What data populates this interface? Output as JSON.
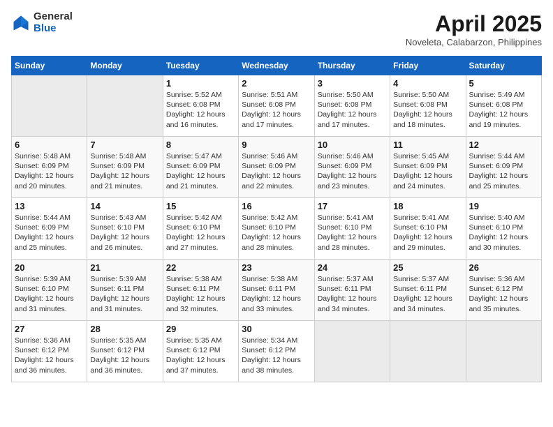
{
  "header": {
    "logo": {
      "line1": "General",
      "line2": "Blue"
    },
    "month_year": "April 2025",
    "location": "Noveleta, Calabarzon, Philippines"
  },
  "weekdays": [
    "Sunday",
    "Monday",
    "Tuesday",
    "Wednesday",
    "Thursday",
    "Friday",
    "Saturday"
  ],
  "weeks": [
    [
      {
        "day": "",
        "sunrise": "",
        "sunset": "",
        "daylight": ""
      },
      {
        "day": "",
        "sunrise": "",
        "sunset": "",
        "daylight": ""
      },
      {
        "day": "1",
        "sunrise": "Sunrise: 5:52 AM",
        "sunset": "Sunset: 6:08 PM",
        "daylight": "Daylight: 12 hours and 16 minutes."
      },
      {
        "day": "2",
        "sunrise": "Sunrise: 5:51 AM",
        "sunset": "Sunset: 6:08 PM",
        "daylight": "Daylight: 12 hours and 17 minutes."
      },
      {
        "day": "3",
        "sunrise": "Sunrise: 5:50 AM",
        "sunset": "Sunset: 6:08 PM",
        "daylight": "Daylight: 12 hours and 17 minutes."
      },
      {
        "day": "4",
        "sunrise": "Sunrise: 5:50 AM",
        "sunset": "Sunset: 6:08 PM",
        "daylight": "Daylight: 12 hours and 18 minutes."
      },
      {
        "day": "5",
        "sunrise": "Sunrise: 5:49 AM",
        "sunset": "Sunset: 6:08 PM",
        "daylight": "Daylight: 12 hours and 19 minutes."
      }
    ],
    [
      {
        "day": "6",
        "sunrise": "Sunrise: 5:48 AM",
        "sunset": "Sunset: 6:09 PM",
        "daylight": "Daylight: 12 hours and 20 minutes."
      },
      {
        "day": "7",
        "sunrise": "Sunrise: 5:48 AM",
        "sunset": "Sunset: 6:09 PM",
        "daylight": "Daylight: 12 hours and 21 minutes."
      },
      {
        "day": "8",
        "sunrise": "Sunrise: 5:47 AM",
        "sunset": "Sunset: 6:09 PM",
        "daylight": "Daylight: 12 hours and 21 minutes."
      },
      {
        "day": "9",
        "sunrise": "Sunrise: 5:46 AM",
        "sunset": "Sunset: 6:09 PM",
        "daylight": "Daylight: 12 hours and 22 minutes."
      },
      {
        "day": "10",
        "sunrise": "Sunrise: 5:46 AM",
        "sunset": "Sunset: 6:09 PM",
        "daylight": "Daylight: 12 hours and 23 minutes."
      },
      {
        "day": "11",
        "sunrise": "Sunrise: 5:45 AM",
        "sunset": "Sunset: 6:09 PM",
        "daylight": "Daylight: 12 hours and 24 minutes."
      },
      {
        "day": "12",
        "sunrise": "Sunrise: 5:44 AM",
        "sunset": "Sunset: 6:09 PM",
        "daylight": "Daylight: 12 hours and 25 minutes."
      }
    ],
    [
      {
        "day": "13",
        "sunrise": "Sunrise: 5:44 AM",
        "sunset": "Sunset: 6:09 PM",
        "daylight": "Daylight: 12 hours and 25 minutes."
      },
      {
        "day": "14",
        "sunrise": "Sunrise: 5:43 AM",
        "sunset": "Sunset: 6:10 PM",
        "daylight": "Daylight: 12 hours and 26 minutes."
      },
      {
        "day": "15",
        "sunrise": "Sunrise: 5:42 AM",
        "sunset": "Sunset: 6:10 PM",
        "daylight": "Daylight: 12 hours and 27 minutes."
      },
      {
        "day": "16",
        "sunrise": "Sunrise: 5:42 AM",
        "sunset": "Sunset: 6:10 PM",
        "daylight": "Daylight: 12 hours and 28 minutes."
      },
      {
        "day": "17",
        "sunrise": "Sunrise: 5:41 AM",
        "sunset": "Sunset: 6:10 PM",
        "daylight": "Daylight: 12 hours and 28 minutes."
      },
      {
        "day": "18",
        "sunrise": "Sunrise: 5:41 AM",
        "sunset": "Sunset: 6:10 PM",
        "daylight": "Daylight: 12 hours and 29 minutes."
      },
      {
        "day": "19",
        "sunrise": "Sunrise: 5:40 AM",
        "sunset": "Sunset: 6:10 PM",
        "daylight": "Daylight: 12 hours and 30 minutes."
      }
    ],
    [
      {
        "day": "20",
        "sunrise": "Sunrise: 5:39 AM",
        "sunset": "Sunset: 6:10 PM",
        "daylight": "Daylight: 12 hours and 31 minutes."
      },
      {
        "day": "21",
        "sunrise": "Sunrise: 5:39 AM",
        "sunset": "Sunset: 6:11 PM",
        "daylight": "Daylight: 12 hours and 31 minutes."
      },
      {
        "day": "22",
        "sunrise": "Sunrise: 5:38 AM",
        "sunset": "Sunset: 6:11 PM",
        "daylight": "Daylight: 12 hours and 32 minutes."
      },
      {
        "day": "23",
        "sunrise": "Sunrise: 5:38 AM",
        "sunset": "Sunset: 6:11 PM",
        "daylight": "Daylight: 12 hours and 33 minutes."
      },
      {
        "day": "24",
        "sunrise": "Sunrise: 5:37 AM",
        "sunset": "Sunset: 6:11 PM",
        "daylight": "Daylight: 12 hours and 34 minutes."
      },
      {
        "day": "25",
        "sunrise": "Sunrise: 5:37 AM",
        "sunset": "Sunset: 6:11 PM",
        "daylight": "Daylight: 12 hours and 34 minutes."
      },
      {
        "day": "26",
        "sunrise": "Sunrise: 5:36 AM",
        "sunset": "Sunset: 6:12 PM",
        "daylight": "Daylight: 12 hours and 35 minutes."
      }
    ],
    [
      {
        "day": "27",
        "sunrise": "Sunrise: 5:36 AM",
        "sunset": "Sunset: 6:12 PM",
        "daylight": "Daylight: 12 hours and 36 minutes."
      },
      {
        "day": "28",
        "sunrise": "Sunrise: 5:35 AM",
        "sunset": "Sunset: 6:12 PM",
        "daylight": "Daylight: 12 hours and 36 minutes."
      },
      {
        "day": "29",
        "sunrise": "Sunrise: 5:35 AM",
        "sunset": "Sunset: 6:12 PM",
        "daylight": "Daylight: 12 hours and 37 minutes."
      },
      {
        "day": "30",
        "sunrise": "Sunrise: 5:34 AM",
        "sunset": "Sunset: 6:12 PM",
        "daylight": "Daylight: 12 hours and 38 minutes."
      },
      {
        "day": "",
        "sunrise": "",
        "sunset": "",
        "daylight": ""
      },
      {
        "day": "",
        "sunrise": "",
        "sunset": "",
        "daylight": ""
      },
      {
        "day": "",
        "sunrise": "",
        "sunset": "",
        "daylight": ""
      }
    ]
  ]
}
